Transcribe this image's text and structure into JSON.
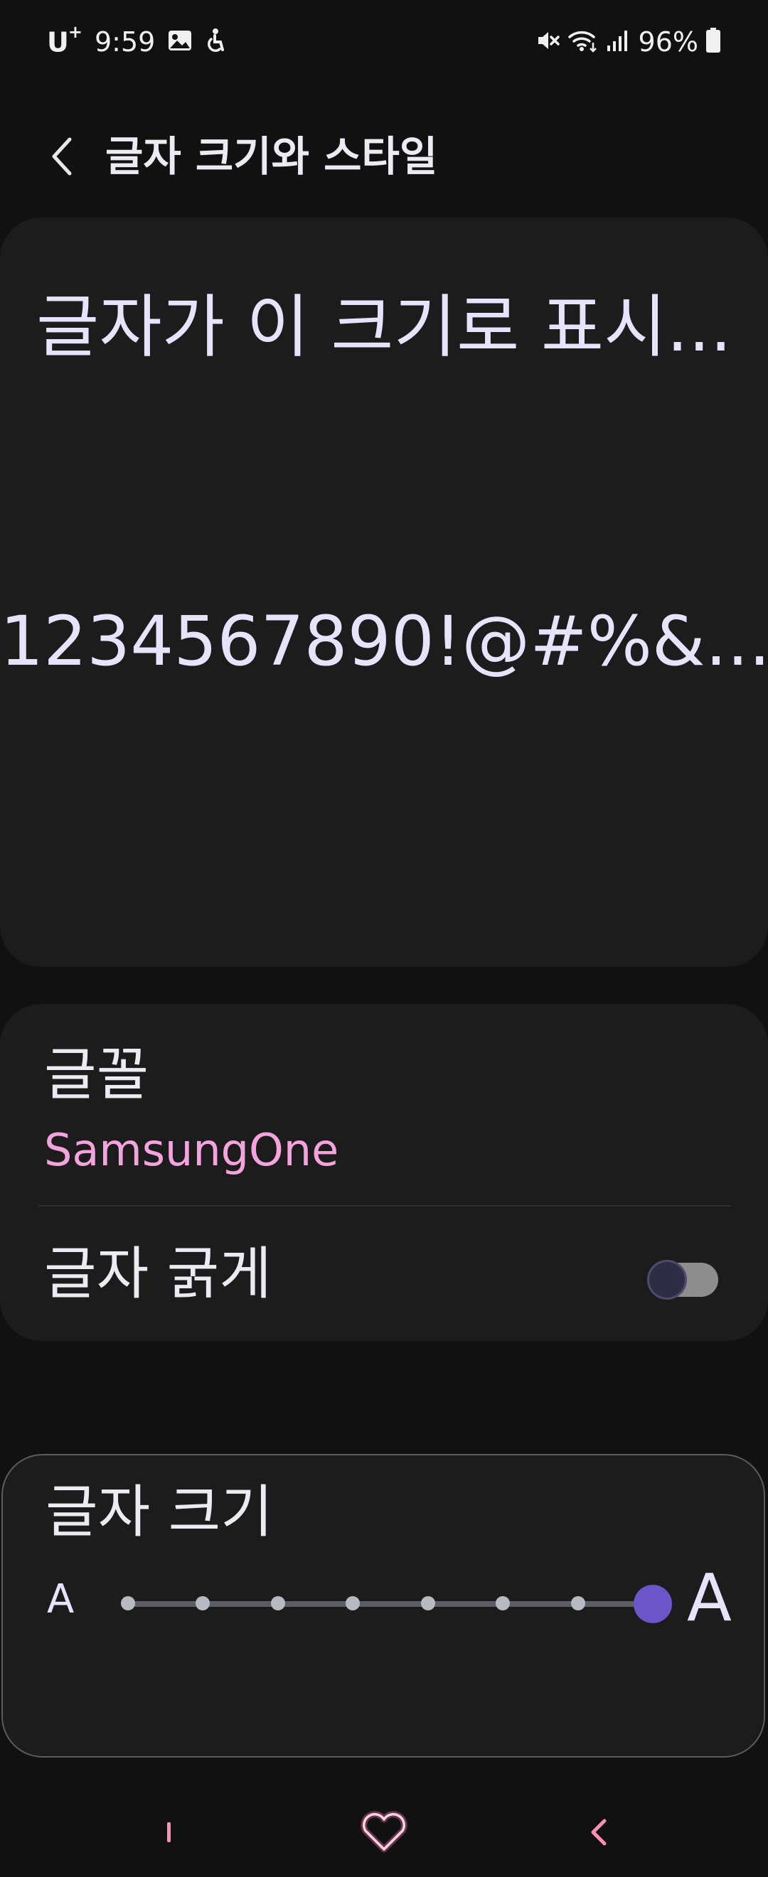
{
  "status_bar": {
    "carrier": "U",
    "carrier_mark": "+",
    "time": "9:59",
    "battery": "96%",
    "icons": [
      "gallery-icon",
      "accessibility-icon",
      "mute-icon",
      "wifi-icon",
      "signal-icon",
      "battery-icon"
    ]
  },
  "header": {
    "title": "글자 크기와 스타일",
    "back_icon": "chevron-left-icon"
  },
  "preview": {
    "line1": "글자가 이 크기로 표시...",
    "line2": "1234567890!@#%&..."
  },
  "settings": {
    "font_label": "글꼴",
    "font_value": "SamsungOne",
    "bold_label": "글자 굵게",
    "bold_enabled": false
  },
  "text_size": {
    "label": "글자 크기",
    "small_label": "A",
    "large_label": "A",
    "steps": 8,
    "selected_step": 8
  },
  "nav_bar": {
    "icons": [
      "recents-icon",
      "home-icon",
      "back-icon"
    ]
  },
  "colors": {
    "background": "#111111",
    "card": "#1c1c1c",
    "accent": "#6a55c9",
    "font_value": "#f4a3dd",
    "nav_icon": "#ff8fb5"
  }
}
